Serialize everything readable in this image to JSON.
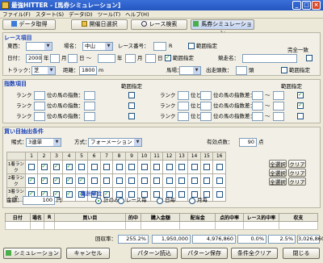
{
  "window": {
    "title": "最強HITTER - [馬券シミュレーション]",
    "min": "_",
    "max": "□",
    "close": "×"
  },
  "menu": [
    "ファイル(F)",
    "スタート(S)",
    "データ(D)",
    "ツール(T)",
    "ヘルプ(H)"
  ],
  "toolbar": {
    "fetch": "データ取得",
    "date_select": "開催日選択",
    "race_search": "レース検索",
    "ticket_sim": "馬券シミュレーション"
  },
  "race": {
    "header": "レース項目",
    "tozai_label": "東西：",
    "tozai_value": "",
    "place_label": "場名：",
    "place_value": "中山",
    "race_no_label": "レース番号：",
    "race_no_value": "",
    "race_no_unit": "R",
    "range_label": "範囲指定",
    "date_label": "日付：",
    "year": "2000",
    "year_unit": "年",
    "month_unit": "月",
    "day_unit": "日 ～",
    "year2_unit": "年",
    "month2_unit": "月",
    "day2_unit": "日",
    "range2_label": "範囲指定",
    "kyoso_label": "競走名：",
    "match_label": "完全一致",
    "track_label": "トラック：",
    "track_value": "芝",
    "distance_label": "距離：",
    "distance_value": "1800",
    "distance_unit": "m",
    "baba_label": "馬場：",
    "tosu_label": "出走頭数：",
    "tosu_unit": "頭",
    "range3_label": "範囲指定"
  },
  "index": {
    "header": "指数項目",
    "range_head1": "範囲指定",
    "range_head2": "範囲指定",
    "rank_label": "ランク",
    "ni_label": "位の馬の指数：",
    "left_rows": [
      {
        "range": false
      },
      {
        "range": false
      },
      {
        "range": false
      }
    ],
    "rank2_label": "ランク",
    "ni2_label": "位と",
    "ni3_label": "位の馬の指数差：",
    "tilde": "～",
    "right_rows": [
      {
        "range": true
      },
      {
        "range": true
      },
      {
        "range": false
      }
    ]
  },
  "buy": {
    "header": "買い目抽出条件",
    "type_label": "賭式：",
    "type_value": "3連単",
    "method_label": "方式：",
    "method_value": "フォーメーション",
    "valid_label": "有効点数：",
    "valid_value": "90",
    "valid_unit": "点",
    "col_heads": [
      "1",
      "2",
      "3",
      "4",
      "5",
      "6",
      "7",
      "8",
      "9",
      "10",
      "11",
      "12",
      "13",
      "14",
      "15",
      "16"
    ],
    "rows": [
      {
        "label": "1着ランク",
        "checks": [
          0,
          1,
          1,
          1,
          0,
          0,
          0,
          0,
          0,
          0,
          0,
          0,
          0,
          0,
          0,
          0
        ]
      },
      {
        "label": "2着ランク",
        "checks": [
          1,
          1,
          1,
          1,
          1,
          0,
          0,
          0,
          0,
          0,
          0,
          0,
          0,
          0,
          0,
          0
        ]
      },
      {
        "label": "3着ランク",
        "checks": [
          1,
          1,
          1,
          1,
          1,
          1,
          1,
          0,
          0,
          0,
          0,
          0,
          0,
          0,
          0,
          0
        ]
      }
    ],
    "all_select": "全選択",
    "clear": "クリア"
  },
  "amount": {
    "label": "金額：",
    "value": "100",
    "unit": "円"
  },
  "aggregate": {
    "label": "集計単位",
    "options": [
      {
        "label": "計のみ",
        "selected": true
      },
      {
        "label": "レース毎",
        "selected": false
      },
      {
        "label": "日毎",
        "selected": false
      },
      {
        "label": "月毎",
        "selected": false
      }
    ]
  },
  "results": {
    "columns": [
      "日付",
      "場名",
      "R",
      "買い目",
      "的中",
      "購入金額",
      "配当金",
      "点的中率",
      "レース的中率",
      "収支"
    ]
  },
  "summary": {
    "label": "回収率：",
    "recovery": "255.2%",
    "purchase": "1,950,000",
    "payout": "4,976,860",
    "point_rate": "0.0%",
    "race_rate": "2.5%",
    "balance": "3,026,860"
  },
  "buttons": {
    "sim": "シミュレーション",
    "cancel": "キャンセル",
    "pattern_load": "パターン読込",
    "pattern_save": "パターン保存",
    "clear_all": "条件全クリア",
    "close": "閉じる"
  }
}
